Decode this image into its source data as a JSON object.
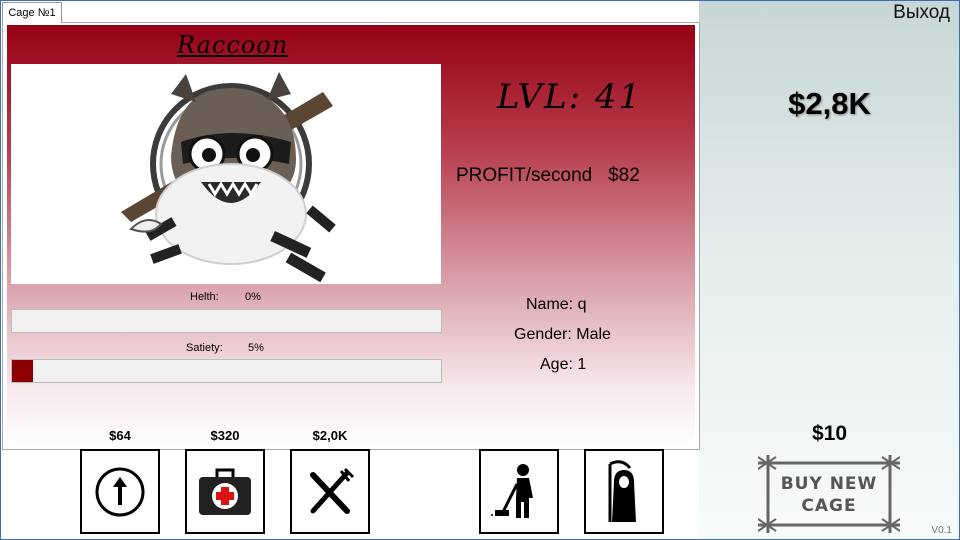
{
  "tab": {
    "label": "Cage №1"
  },
  "animal": {
    "species": "Raccoon",
    "image_icon": "raccoon-mascot-icon",
    "level_text": "LVL: 41",
    "profit_label": "PROFIT/second",
    "profit_value": "$82",
    "health_label": "Helth:",
    "health_value": "0%",
    "health_fraction": 0.0,
    "satiety_label": "Satiety:",
    "satiety_value": "5%",
    "satiety_fraction": 0.05,
    "name_text": "Name: q",
    "gender_text": "Gender: Male",
    "age_text": "Age: 1"
  },
  "actions": [
    {
      "price": "$64",
      "icon": "level-up-icon"
    },
    {
      "price": "$320",
      "icon": "medkit-icon"
    },
    {
      "price": "$2,0K",
      "icon": "food-icon"
    },
    {
      "icon": "clean-cage-icon"
    },
    {
      "icon": "grim-reaper-icon"
    }
  ],
  "right": {
    "exit_label": "Выход",
    "money": "$2,8K",
    "new_cage_price": "$10",
    "buy_cage_line1": "BUY NEW",
    "buy_cage_line2": "CAGE",
    "version": "V0.1"
  },
  "colors": {
    "accent": "#960015",
    "satiety_fill": "#8b0000"
  }
}
